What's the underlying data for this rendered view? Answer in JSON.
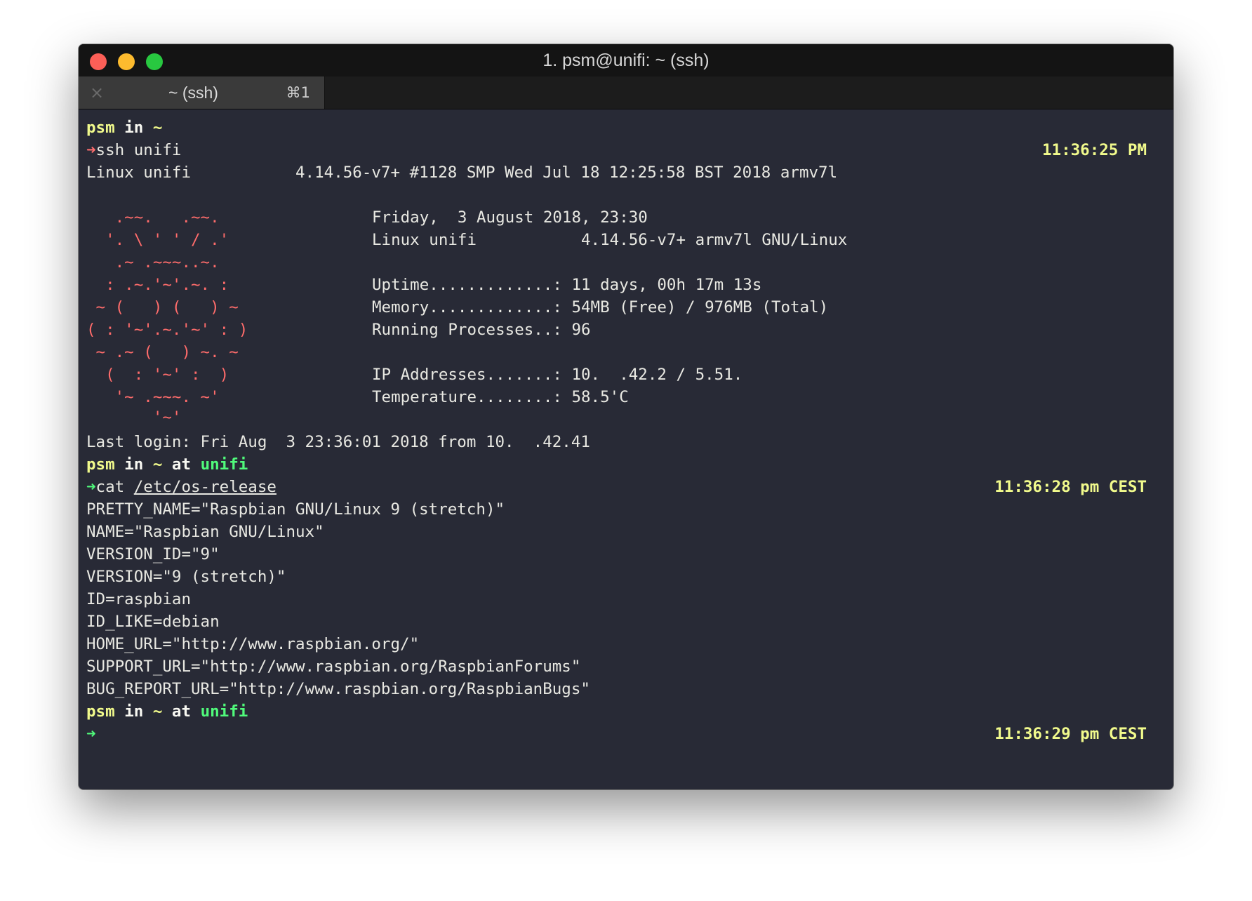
{
  "window": {
    "title": "1. psm@unifi: ~ (ssh)"
  },
  "tab": {
    "close_glyph": "×",
    "label": "~ (ssh)",
    "shortcut": "⌘1"
  },
  "terminal": {
    "prompt1": {
      "user": "psm",
      "in": "in",
      "dir": "~"
    },
    "cmd1": {
      "arrow": "➜",
      "text": "ssh unifi",
      "time": "11:36:25 PM"
    },
    "uname": "Linux unifi           4.14.56-v7+ #1128 SMP Wed Jul 18 12:25:58 BST 2018 armv7l",
    "motd_art": [
      "   .~~.   .~~.",
      "  '. \\ ' ' / .'",
      "   .~ .~~~..~.",
      "  : .~.'~'.~. :",
      " ~ (   ) (   ) ~",
      "( : '~'.~.'~' : )",
      " ~ .~ (   ) ~. ~",
      "  (  : '~' :  )",
      "   '~ .~~~. ~'",
      "       '~'"
    ],
    "motd_info": {
      "date": "Friday,  3 August 2018, 23:30",
      "system": "Linux unifi           4.14.56-v7+ armv7l GNU/Linux",
      "uptime": "Uptime.............: 11 days, 00h 17m 13s",
      "memory": "Memory.............: 54MB (Free) / 976MB (Total)",
      "processes": "Running Processes..: 96",
      "ip": "IP Addresses.......: 10.  .42.2 / 5.51.",
      "temperature": "Temperature........: 58.5'C"
    },
    "last_login": "Last login: Fri Aug  3 23:36:01 2018 from 10.  .42.41",
    "prompt2": {
      "user": "psm",
      "in": "in",
      "dir": "~",
      "at": "at",
      "host": "unifi"
    },
    "cmd2": {
      "arrow": "➜",
      "cmd": "cat",
      "path": "/etc/os-release",
      "time": "11:36:28 pm CEST"
    },
    "os_release": [
      "PRETTY_NAME=\"Raspbian GNU/Linux 9 (stretch)\"",
      "NAME=\"Raspbian GNU/Linux\"",
      "VERSION_ID=\"9\"",
      "VERSION=\"9 (stretch)\"",
      "ID=raspbian",
      "ID_LIKE=debian",
      "HOME_URL=\"http://www.raspbian.org/\"",
      "SUPPORT_URL=\"http://www.raspbian.org/RaspbianForums\"",
      "BUG_REPORT_URL=\"http://www.raspbian.org/RaspbianBugs\""
    ],
    "prompt3": {
      "user": "psm",
      "in": "in",
      "dir": "~",
      "at": "at",
      "host": "unifi"
    },
    "cmd3": {
      "arrow": "➜",
      "time": "11:36:29 pm CEST"
    }
  },
  "colors": {
    "background": "#282a36",
    "prompt_yellow": "#f1fa8c",
    "host_green": "#50fa7b",
    "arrow_red": "#ff5555",
    "motd_art": "#ff6c6b"
  }
}
